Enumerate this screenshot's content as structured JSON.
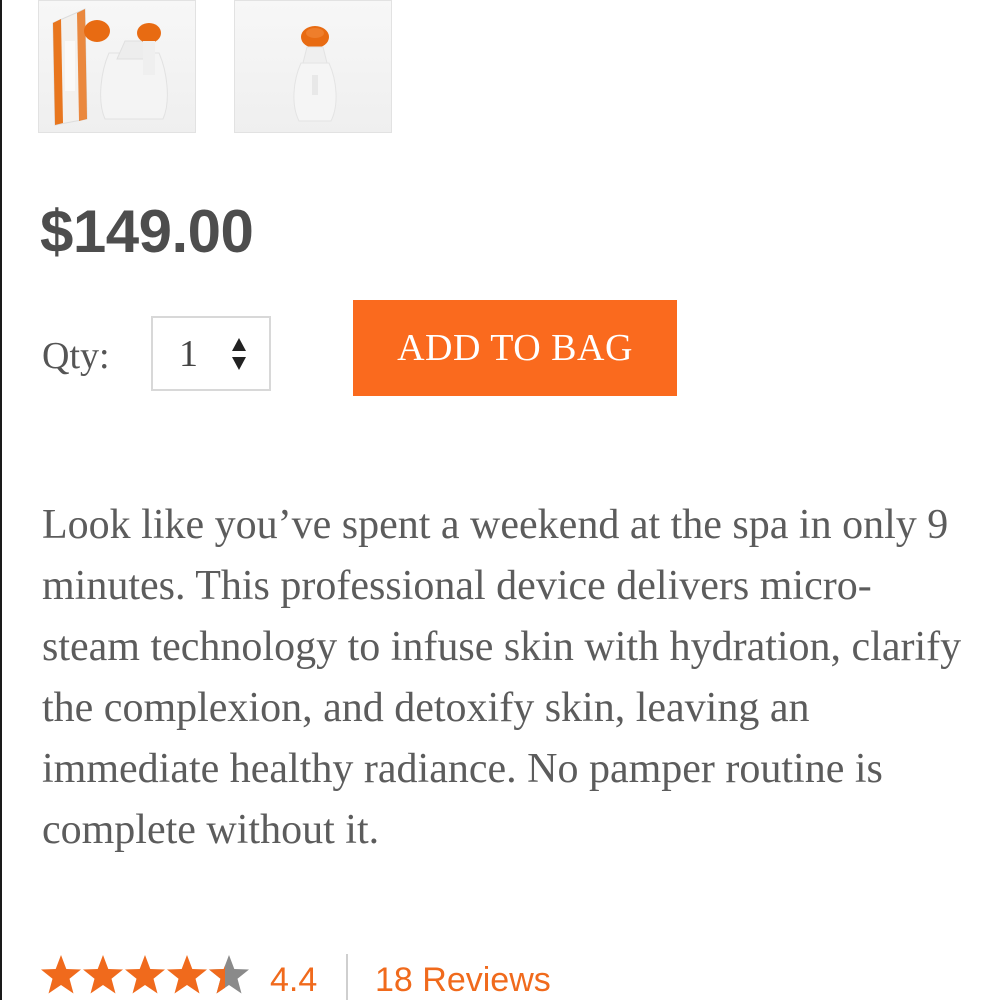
{
  "gallery": {
    "thumbnails": [
      {
        "icon": "product-box-and-steamer-image"
      },
      {
        "icon": "product-steamer-image"
      }
    ]
  },
  "product": {
    "price": "$149.00",
    "quantity": {
      "label": "Qty:",
      "value": "1",
      "icon": "stepper-arrows-icon"
    },
    "add_to_bag_label": "ADD TO BAG",
    "description": "Look like you’ve spent a weekend at the spa in only 9 minutes. This professional device delivers micro-steam technology to infuse skin with hydration, clarify the complexion, and detoxify skin, leaving an immediate healthy radiance. No pamper routine is complete without it.",
    "rating": {
      "value": "4.4",
      "stars_filled": 4.4,
      "stars_total": 5,
      "reviews_label": "18 Reviews"
    }
  },
  "colors": {
    "accent": "#fa6a1e",
    "rating_text": "#f06a1c",
    "star_empty": "#8a8a8a",
    "price_text": "#4d4d4d",
    "body_text": "#5c5c5c"
  }
}
